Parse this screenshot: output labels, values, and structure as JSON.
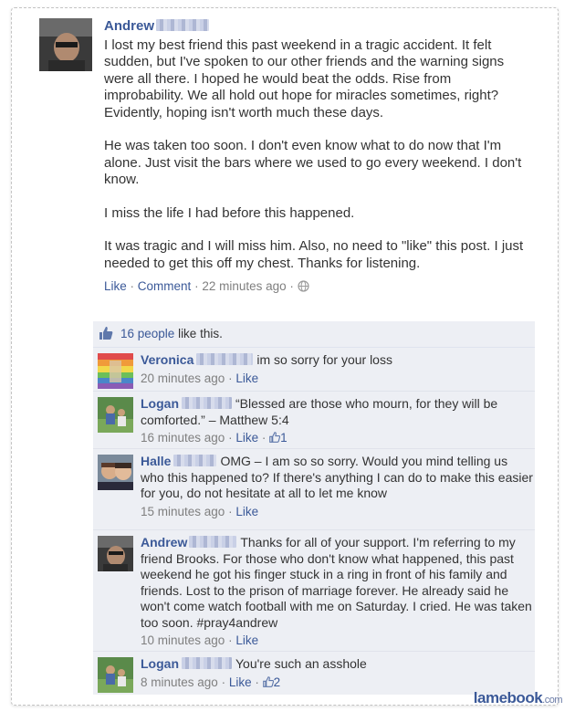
{
  "post": {
    "author": "Andrew",
    "paragraphs": [
      "I lost my best friend this past weekend in a tragic accident. It felt sudden, but I've spoken to our other friends and the warning signs were all there. I hoped he would beat the odds. Rise from improbability. We all hold out hope for miracles sometimes, right? Evidently, hoping isn't worth much these days.",
      "He was taken too soon. I don't even know what to do now that I'm alone. Just visit the bars where we used to go every weekend. I don't know.",
      "I miss the life I had before this happened.",
      "It was tragic and I will miss him. Also, no need to \"like\" this post. I just needed to get this off my chest. Thanks for listening."
    ],
    "actions": {
      "like": "Like",
      "comment": "Comment",
      "time": "22 minutes ago",
      "sep": "·"
    },
    "icons": {
      "privacy": "globe-icon"
    }
  },
  "likes": {
    "people": "16 people",
    "suffix": " like this."
  },
  "comments": [
    {
      "author": "Veronica",
      "text": "im so sorry for your loss",
      "time": "20 minutes ago",
      "like": "Like",
      "like_count": ""
    },
    {
      "author": "Logan",
      "text": "“Blessed are those who mourn, for they will be comforted.” – Matthew 5:4",
      "time": "16 minutes ago",
      "like": "Like",
      "like_count": "1"
    },
    {
      "author": "Halle",
      "text": "OMG – I am so so sorry. Would you mind telling us who this happened to? If there's anything I can do to make this easier for you, do not hesitate at all to let me know",
      "time": "15 minutes ago",
      "like": "Like",
      "like_count": ""
    },
    {
      "author": "Andrew",
      "text": "Thanks for all of your support. I'm referring to my friend Brooks. For those who don't know what happened, this past weekend he got his finger stuck in a ring in front of his family and friends. Lost to the prison of marriage forever. He already said he won't come watch football with me on Saturday. I cried. He was taken too soon. #pray4andrew",
      "time": "10 minutes ago",
      "like": "Like",
      "like_count": ""
    },
    {
      "author": "Logan",
      "text": "You're such an asshole",
      "time": "8 minutes ago",
      "like": "Like",
      "like_count": "2"
    }
  ],
  "watermark": {
    "name": "lamebook",
    "domain": ".com"
  },
  "colors": {
    "link": "#3b5998",
    "meta": "#7f7f7f",
    "comment_bg": "#edeff4"
  }
}
